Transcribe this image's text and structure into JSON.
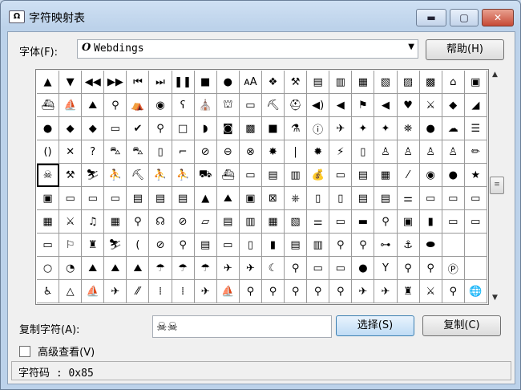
{
  "window": {
    "title": "字符映射表",
    "app_icon": "charmap-app-icon",
    "controls": {
      "minimize": "▬",
      "maximize": "▢",
      "close": "✕"
    }
  },
  "font": {
    "label": "字体(F):",
    "selected": "Webdings",
    "font_glyph": "O",
    "help_button": "帮助(H)"
  },
  "grid": {
    "selected_index": 80,
    "rows": [
      [
        "▲",
        "▼",
        "◀◀",
        "▶▶",
        "⏮",
        "⏭",
        "❚❚",
        "■",
        "●",
        "ᴀA",
        "❖",
        "⚒",
        "▤",
        "▥",
        "▦",
        "▧",
        "▨",
        "▩",
        "⌂",
        "▣"
      ],
      [
        "⛴",
        "⛵",
        "⛰",
        "⚲",
        "⛺",
        "◉",
        "ʕ",
        "⛪",
        "⛫",
        "▭",
        "⛏",
        "⛑",
        "◀)",
        "◀",
        "⚑",
        "◀",
        "♥",
        "⚔",
        "◆",
        "◢"
      ],
      [
        "●",
        "◆",
        "◆",
        "▭",
        "✔",
        "⚲",
        "□",
        "◗",
        "◙",
        "▩",
        "■",
        "⚗",
        "ⓘ",
        "✈",
        "✦",
        "✦",
        "⛯",
        "●",
        "☁",
        "☰"
      ],
      [
        "()",
        "✕",
        "?",
        "⛍",
        "⛍",
        "▯",
        "⌐",
        "⊘",
        "⊖",
        "⊗",
        "✸",
        "|",
        "✹",
        "⚡",
        "▯",
        "♙",
        "♙",
        "♙",
        "♙",
        "✏"
      ],
      [
        "☠",
        "⚒",
        "⛷",
        "⛹",
        "⛏",
        "⛹",
        "⛹",
        "⛟",
        "⛴",
        "▭",
        "▤",
        "▥",
        "💰",
        "▭",
        "▤",
        "▦",
        "⁄",
        "◉",
        "●",
        "★"
      ],
      [
        "▣",
        "▭",
        "▭",
        "▭",
        "▤",
        "▤",
        "▤",
        "▲",
        "⛰",
        "▣",
        "⊠",
        "⎈",
        "▯",
        "▯",
        "▤",
        "▤",
        "⚌",
        "▭",
        "▭",
        "▭"
      ],
      [
        "▦",
        "⚔",
        "♫",
        "▦",
        "⚲",
        "☊",
        "⊘",
        "▱",
        "▤",
        "▥",
        "▦",
        "▧",
        "⚌",
        "▭",
        "▬",
        "⚲",
        "▣",
        "▮",
        "▭",
        "▭"
      ],
      [
        "▭",
        "⚐",
        "♜",
        "⛷",
        "(",
        "⊘",
        "⚲",
        "▤",
        "▭",
        "▯",
        "▮",
        "▤",
        "▥",
        "⚲",
        "⚲",
        "⊶",
        "⚓",
        "⬬"
      ],
      [
        "○",
        "◔",
        "⛰",
        "⛰",
        "⛰",
        "☂",
        "☂",
        "☂",
        "✈",
        "✈",
        "☾",
        "⚲",
        "▭",
        "▭",
        "●",
        "Y",
        "⚲",
        "⚲",
        "Ⓟ"
      ],
      [
        "♿",
        "△",
        "⛵",
        "✈",
        "⁄⁄",
        "⁞",
        "⁞",
        "✈",
        "⛵",
        "⚲",
        "⚲",
        "⚲",
        "⚲",
        "⚲",
        "✈",
        "✈",
        "♜",
        "⚔",
        "⚲",
        "🌐"
      ]
    ]
  },
  "scrollbar": {
    "up": "▲",
    "down": "▼",
    "thumb": "≡"
  },
  "copy": {
    "label": "复制字符(A):",
    "value": "☠☠",
    "select_button": "选择(S)",
    "copy_button": "复制(C)"
  },
  "advanced_view": {
    "label": "高级查看(V)",
    "checked": false
  },
  "status": {
    "text": "字符码 : 0x85"
  }
}
